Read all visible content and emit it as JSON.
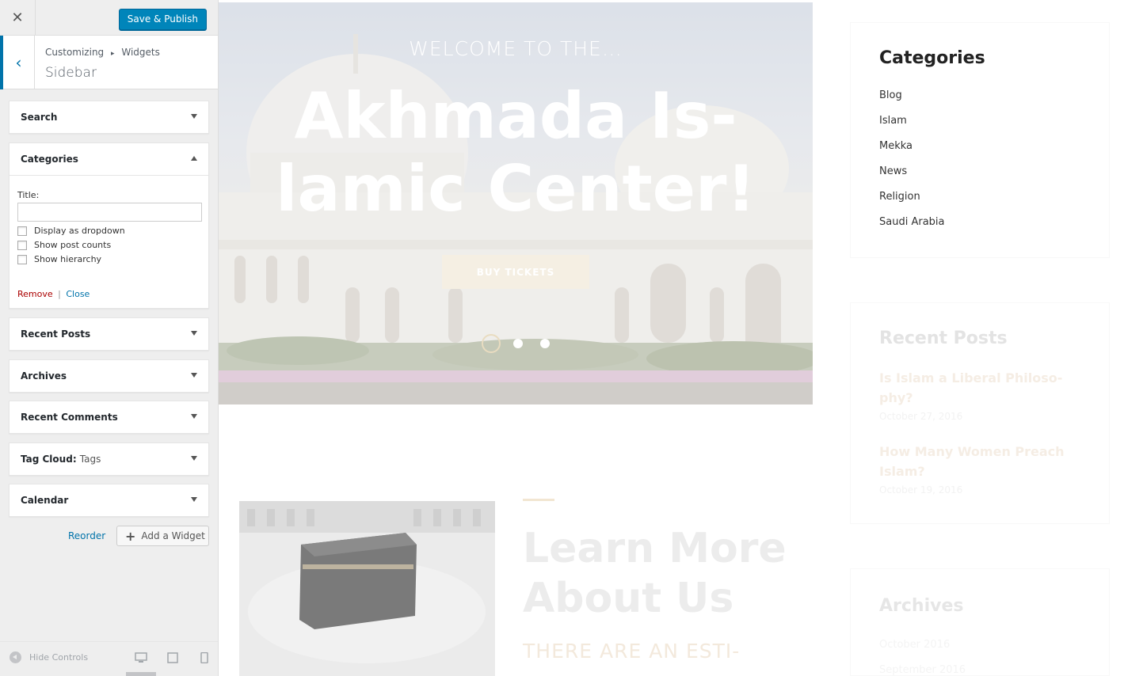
{
  "customizer": {
    "close_icon": "close-icon",
    "publish_label": "Save & Publish",
    "breadcrumb": {
      "root": "Customizing",
      "separator": "▸",
      "parent": "Widgets"
    },
    "panel_title": "Sidebar",
    "widgets": [
      {
        "title": "Search"
      },
      {
        "title": "Categories"
      },
      {
        "title": "Recent Posts"
      },
      {
        "title": "Archives"
      },
      {
        "title": "Recent Comments"
      },
      {
        "title": "Tag Cloud",
        "subtitle": "Tags"
      },
      {
        "title": "Calendar"
      }
    ],
    "categories_form": {
      "title_label": "Title:",
      "title_value": "",
      "options": [
        {
          "label": "Display as dropdown",
          "checked": false
        },
        {
          "label": "Show post counts",
          "checked": false
        },
        {
          "label": "Show hierarchy",
          "checked": false
        }
      ],
      "remove_label": "Remove",
      "link_separator": "|",
      "close_label": "Close"
    },
    "reorder_label": "Reorder",
    "add_widget_label": "Add a Widget",
    "footer": {
      "hide_controls_label": "Hide Controls",
      "active_device": "desktop"
    },
    "colors": {
      "accent": "#0085ba",
      "remove": "#aa0000",
      "link": "#0073aa"
    }
  },
  "preview": {
    "hero": {
      "welcome": "WELCOME TO THE…",
      "title_line1": "Akhmada Is-",
      "title_line2": "lamic Center!",
      "button": "BUY TICKETS",
      "slides": 3,
      "active_slide": 1
    },
    "about": {
      "title_line1": "Learn More",
      "title_line2": "About Us",
      "subtitle": "THERE ARE AN ESTI-"
    },
    "sidebar": {
      "categories_title": "Categories",
      "categories": [
        "Blog",
        "Islam",
        "Mekka",
        "News",
        "Religion",
        "Saudi Arabia"
      ],
      "recent_posts_title": "Recent Posts",
      "recent_posts": [
        {
          "title_line1": "Is Islam a Liberal Philoso-",
          "title_line2": "phy?",
          "date": "October 27, 2016"
        },
        {
          "title_line1": "How Many Women Preach",
          "title_line2": "Islam?",
          "date": "October 19, 2016"
        }
      ],
      "archives_title": "Archives",
      "archives": [
        "October 2016",
        "September 2016"
      ]
    },
    "colors": {
      "accent": "#e9dcc0",
      "heading": "#222222"
    }
  }
}
